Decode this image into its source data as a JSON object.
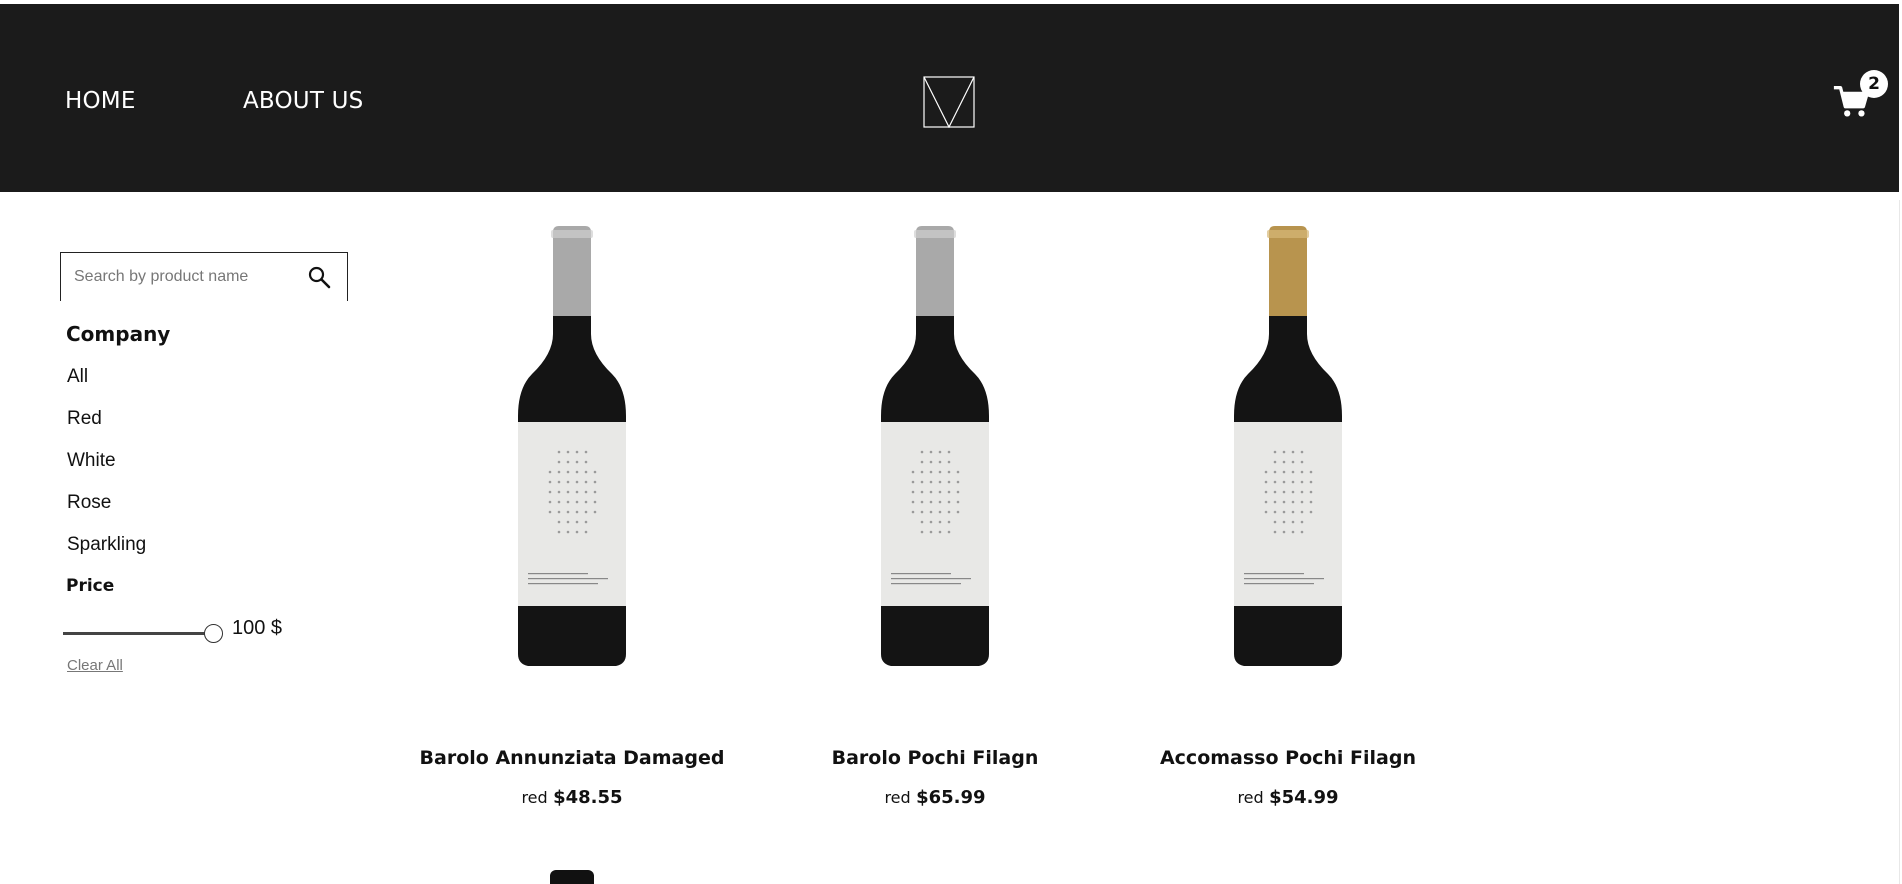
{
  "header": {
    "nav": [
      {
        "label": "HOME"
      },
      {
        "label": "ABOUT US"
      }
    ],
    "cart_count": "2"
  },
  "sidebar": {
    "search_placeholder": "Search by product name",
    "company_title": "Company",
    "categories": [
      "All",
      "Red",
      "White",
      "Rose",
      "Sparkling"
    ],
    "price_title": "Price",
    "price_value": "100 $",
    "price_fraction": 1.0,
    "clear_label": "Clear All"
  },
  "products": [
    {
      "name": "Barolo Annunziata Damaged",
      "category": "red",
      "price": "$48.55",
      "capsule": "#a9a9a9"
    },
    {
      "name": "Barolo Pochi Filagn",
      "category": "red",
      "price": "$65.99",
      "capsule": "#a9a9a9"
    },
    {
      "name": "Accomasso Pochi Filagn",
      "category": "red",
      "price": "$54.99",
      "capsule": "#b8944e"
    }
  ],
  "colors": {
    "header_bg": "#1b1b1b",
    "bottle": "#141414",
    "label": "#e8e8e6"
  }
}
